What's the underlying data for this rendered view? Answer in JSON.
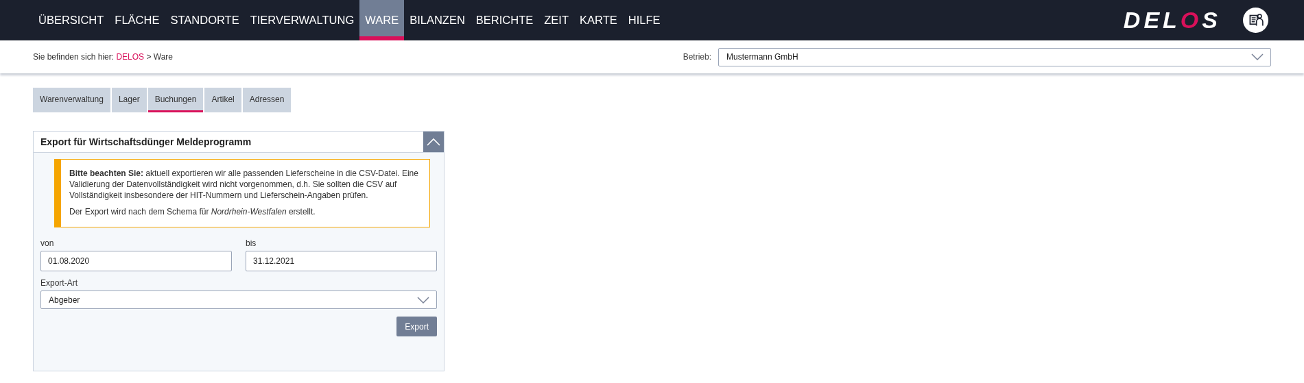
{
  "nav": {
    "items": [
      {
        "label": "ÜBERSICHT",
        "selected": false
      },
      {
        "label": "FLÄCHE",
        "selected": false
      },
      {
        "label": "STANDORTE",
        "selected": false
      },
      {
        "label": "TIERVERWALTUNG",
        "selected": false
      },
      {
        "label": "WARE",
        "selected": true
      },
      {
        "label": "BILANZEN",
        "selected": false
      },
      {
        "label": "BERICHTE",
        "selected": false
      },
      {
        "label": "ZEIT",
        "selected": false
      },
      {
        "label": "KARTE",
        "selected": false
      },
      {
        "label": "HILFE",
        "selected": false
      }
    ],
    "logo": {
      "before": "DEL",
      "accent": "O",
      "after": "S"
    }
  },
  "breadcrumb": {
    "prefix": "Sie befinden sich hier:",
    "link": "DELOS",
    "separator": ">",
    "current": "Ware"
  },
  "betrieb": {
    "label": "Betrieb:",
    "value": "Mustermann GmbH"
  },
  "tabs": [
    {
      "label": "Warenverwaltung",
      "selected": false
    },
    {
      "label": "Lager",
      "selected": false
    },
    {
      "label": "Buchungen",
      "selected": true
    },
    {
      "label": "Artikel",
      "selected": false
    },
    {
      "label": "Adressen",
      "selected": false
    }
  ],
  "panel": {
    "title": "Export für Wirtschaftsdünger Meldeprogramm",
    "expanded": true,
    "notice": [
      "**Bitte beachten Sie:** aktuell exportieren wir alle passenden Lieferscheine in die CSV-Datei. Eine Validierung der Datenvollständigkeit wird nicht vorgenommen, d.h. Sie sollten die CSV auf Vollständigkeit insbesondere der HIT-Nummern und Lieferschein-Angaben prüfen.",
      "Der Export wird nach dem Schema für *Nordrhein-Westfalen* erstellt."
    ],
    "from": {
      "label": "von",
      "value": "01.08.2020"
    },
    "to": {
      "label": "bis",
      "value": "31.12.2021"
    },
    "export_type": {
      "label": "Export-Art",
      "value": "Abgeber"
    },
    "button": "Export"
  }
}
